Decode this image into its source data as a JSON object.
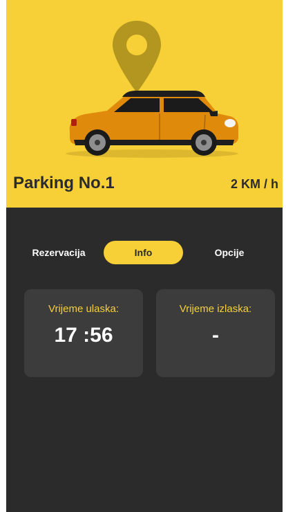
{
  "header": {
    "title": "Parking No.1",
    "rate": "2 KM / h"
  },
  "tabs": [
    {
      "label": "Rezervacija",
      "active": false
    },
    {
      "label": "Info",
      "active": true
    },
    {
      "label": "Opcije",
      "active": false
    }
  ],
  "entry": {
    "label": "Vrijeme ulaska:",
    "value": "17 :56"
  },
  "exit": {
    "label": "Vrijeme izlaska:",
    "value": "-"
  },
  "colors": {
    "accent": "#f7cf36",
    "background": "#2b2b2b",
    "card": "#3c3c3c",
    "car_body": "#e08a0c"
  },
  "icons": {
    "pin": "location-pin-icon",
    "car": "car-illustration"
  }
}
